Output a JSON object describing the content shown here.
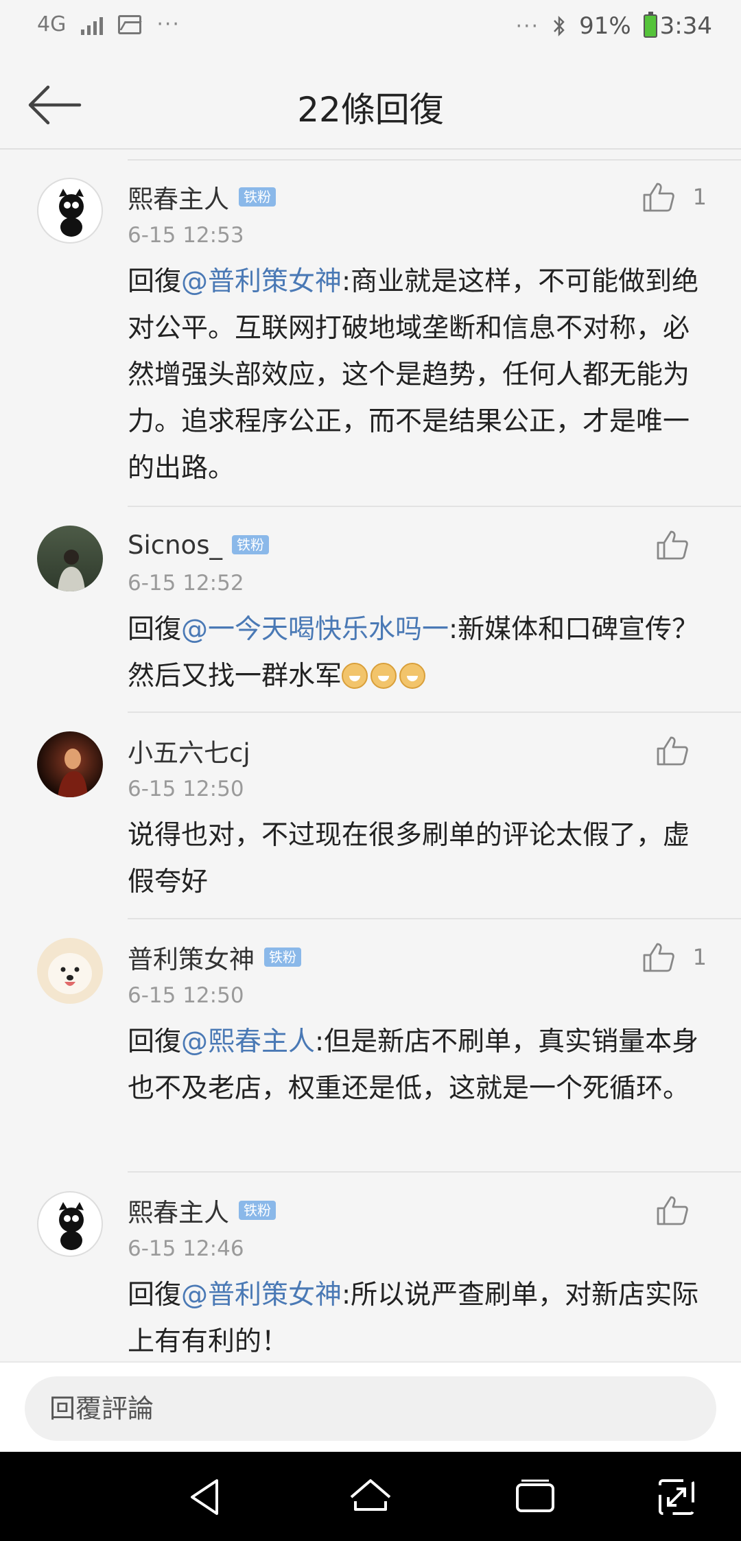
{
  "status_bar": {
    "network": "4G",
    "dots_left": "···",
    "dots_right": "···",
    "battery_percent": "91%",
    "time": "3:34"
  },
  "header": {
    "title": "22條回復"
  },
  "comments": [
    {
      "username": "熙春主人",
      "badge": "铁粉",
      "time": "6-15 12:53",
      "likes": "1",
      "reply_prefix": "回復",
      "mention": "@普利策女神",
      "text": ":商业就是这样，不可能做到绝对公平。互联网打破地域垄断和信息不对称，必然增强头部效应，这个是趋势，任何人都无能为力。追求程序公正，而不是结果公正，才是唯一的出路。"
    },
    {
      "username": "Sicnos_",
      "badge": "铁粉",
      "time": "6-15 12:52",
      "likes": "",
      "reply_prefix": "回復",
      "mention": "@一今天喝快乐水吗一",
      "text": ":新媒体和口碑宣传？然后又找一群水军"
    },
    {
      "username": "小五六七cj",
      "badge": "",
      "time": "6-15 12:50",
      "likes": "",
      "reply_prefix": "",
      "mention": "",
      "text": "说得也对，不过现在很多刷单的评论太假了，虚假夸好"
    },
    {
      "username": "普利策女神",
      "badge": "铁粉",
      "time": "6-15 12:50",
      "likes": "1",
      "reply_prefix": "回復",
      "mention": "@熙春主人",
      "text": ":但是新店不刷单，真实销量本身也不及老店，权重还是低，这就是一个死循环。"
    },
    {
      "username": "熙春主人",
      "badge": "铁粉",
      "time": "6-15 12:46",
      "likes": "",
      "reply_prefix": "回復",
      "mention": "@普利策女神",
      "text": ":所以说严查刷单，对新店实际上有有利的！"
    }
  ],
  "reply_bar": {
    "placeholder": "回覆評論"
  },
  "colors": {
    "mention": "#4a79b5",
    "badge": "#8ab8e9",
    "battery": "#55c33a"
  }
}
